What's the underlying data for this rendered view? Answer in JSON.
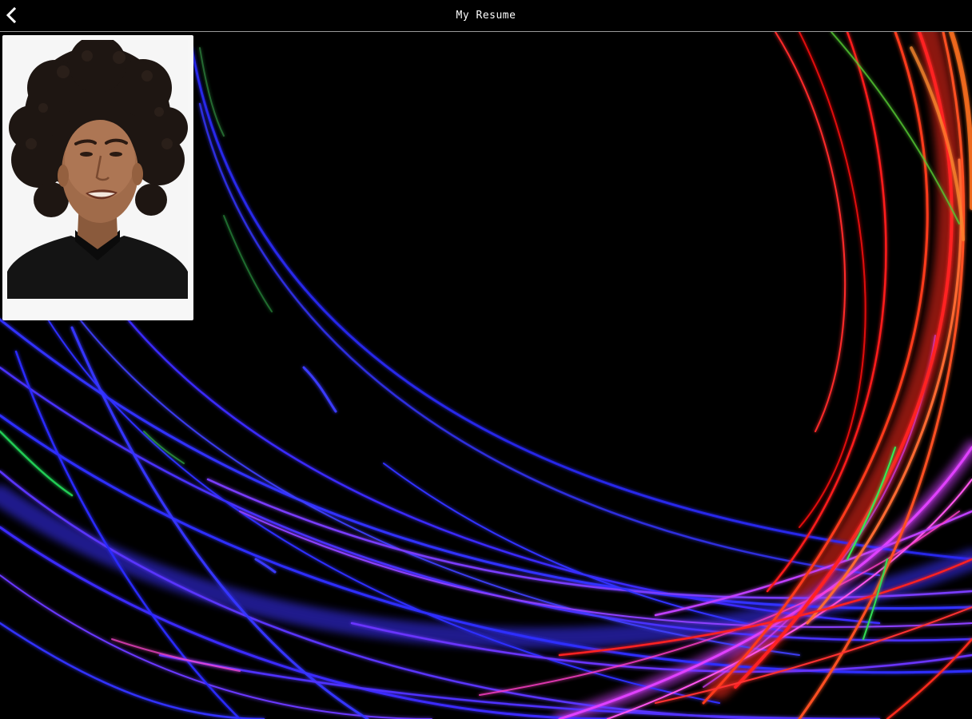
{
  "app": {
    "title": "My Resume"
  },
  "header": {
    "back_icon": "chevron-left-icon"
  },
  "profile": {
    "photo_icon": "profile-photo"
  },
  "background": {
    "style": "light-streaks",
    "colors": {
      "base": "#000000",
      "blue": "#2f2fff",
      "violet": "#7a33ff",
      "magenta": "#e040ff",
      "red": "#ff1a1a",
      "orange": "#ff5a1a",
      "green": "#33dd55"
    }
  }
}
